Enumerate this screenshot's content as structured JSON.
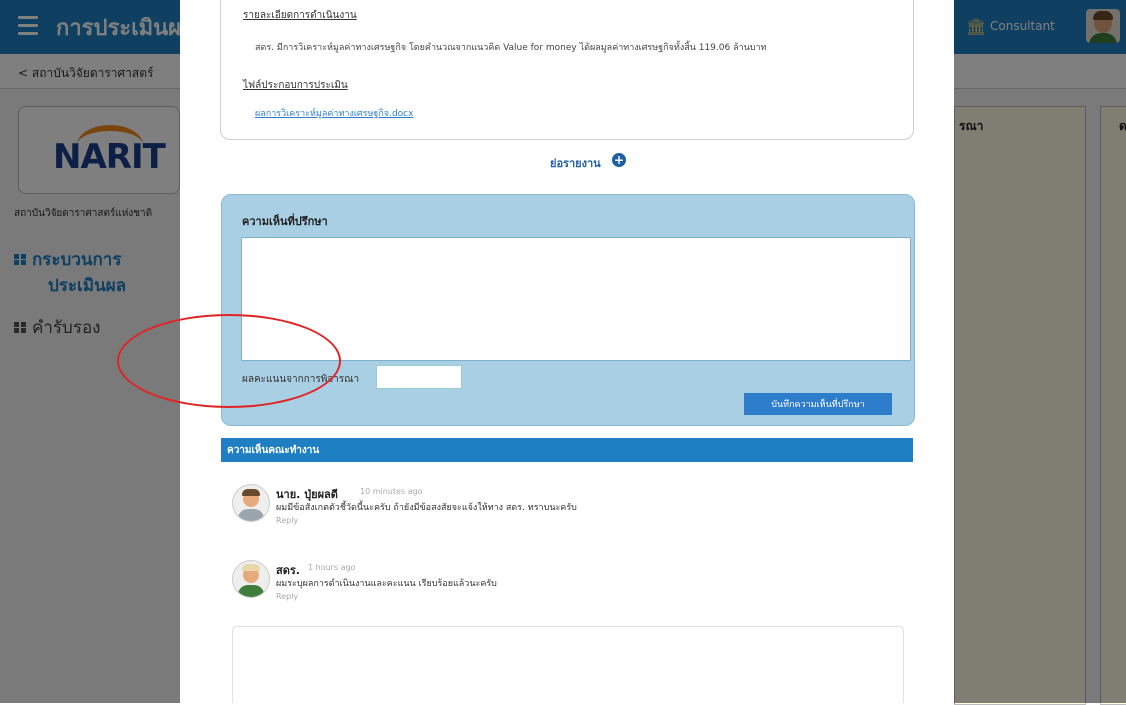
{
  "header": {
    "app_title": "การประเมินผล",
    "user_role": "Consultant"
  },
  "breadcrumb": {
    "back_label": "< สถาบันวิจัยดาราศาสตร์"
  },
  "sidebar": {
    "logo_text": "NARIT",
    "org_name": "สถาบันวิจัยดาราศาสตร์แห่งชาติ",
    "items": [
      {
        "label_line1": "กระบวนการ",
        "label_line2": "ประเมินผล",
        "active": true
      },
      {
        "label_line1": "คำรับรอง",
        "active": false
      }
    ]
  },
  "background_panels": {
    "panel1_label": "รณา",
    "panel2_label": "ด"
  },
  "modal": {
    "detail": {
      "section1_label": "รายละเอียดการดำเนินงาน",
      "section1_text": "สดร. มีการวิเคราะห์มูลค่าทางเศรษฐกิจ โดยคำนวณจากแนวคิด Value for money ได้ผลมูลค่าทางเศรษฐกิจทั้งสิ้น 119.06 ล้านบาท",
      "section2_label": "ไฟล์ประกอบการประเมิน",
      "file_name": "ผลการวิเคราะห์มูลค่าทางเศรษฐกิจ.docx"
    },
    "report_toggle": "ย่อรายงาน",
    "consultant": {
      "title": "ความเห็นที่ปรึกษา",
      "textarea_value": "",
      "score_label": "ผลคะแนนจากการพิจารณา",
      "score_value": "",
      "save_label": "บันทึกความเห็นที่ปรึกษา"
    },
    "committee": {
      "title": "ความเห็นคณะทำงาน",
      "comments": [
        {
          "author": "นาย. ปุ่ยผลดี",
          "time": "10 minutes ago",
          "text": "ผมมีข้อสังเกตตัวชี้วัดนี้นะครับ ถ้ายังมีข้อสงสัยจะแจ้งให้ทาง สดร. ทราบนะครับ",
          "reply": "Reply"
        },
        {
          "author": "สดร.",
          "time": "1 hours ago",
          "text": "ผมระบุผลการดำเนินงานและคะแนน เรียบร้อยแล้วนะครับ",
          "reply": "Reply"
        }
      ]
    }
  },
  "colors": {
    "primary": "#1f7fc3",
    "consult_box": "#a8cfe3",
    "highlight": "#e02424"
  }
}
